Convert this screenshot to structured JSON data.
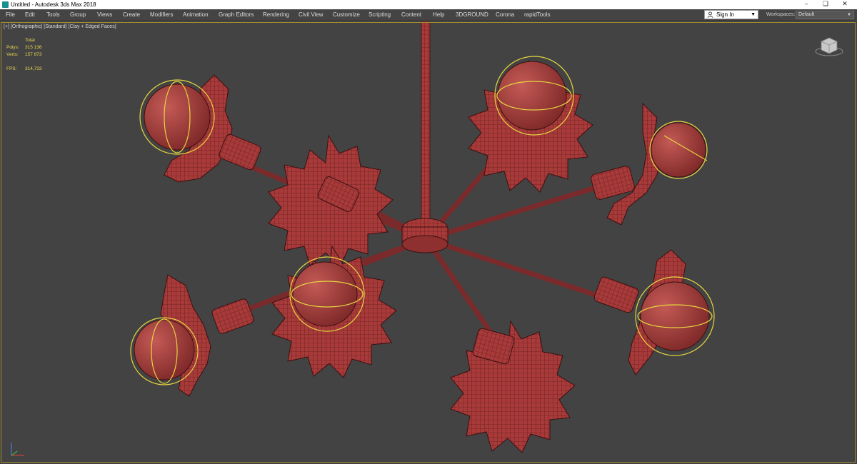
{
  "window": {
    "title": "Untitled - Autodesk 3ds Max 2018",
    "controls": [
      "–",
      "❏",
      "✕"
    ]
  },
  "menu": {
    "items": [
      "File",
      "Edit",
      "Tools",
      "Group",
      "Views",
      "Create",
      "Modifiers",
      "Animation",
      "Graph Editors",
      "Rendering",
      "Civil View",
      "Customize",
      "Scripting",
      "Content",
      "Help",
      "3DGROUND",
      "Corona",
      "rapidTools"
    ],
    "sign_in": "Sign In",
    "workspaces_label": "Workspaces:",
    "workspaces_value": "Default"
  },
  "viewport": {
    "label_plus": "[+]",
    "label_view": "[Orthographic]",
    "label_shading": "[Standard]",
    "label_style": "[Clay + Edged Faces]",
    "stats": {
      "total_label": "Total",
      "polys_label": "Polys:",
      "polys_value": "315 136",
      "verts_label": "Verts:",
      "verts_value": "157 873",
      "fps_label": "FPS:",
      "fps_value": "314,733"
    }
  },
  "colors": {
    "model": "#a83a3a",
    "wire": "#4a1414",
    "gizmo": "#e6d640",
    "viewport_bg": "#434343",
    "stats_text": "#e8d650"
  },
  "icons": [
    "app-icon",
    "user-icon",
    "viewcube-icon",
    "axis-tripod-icon"
  ]
}
